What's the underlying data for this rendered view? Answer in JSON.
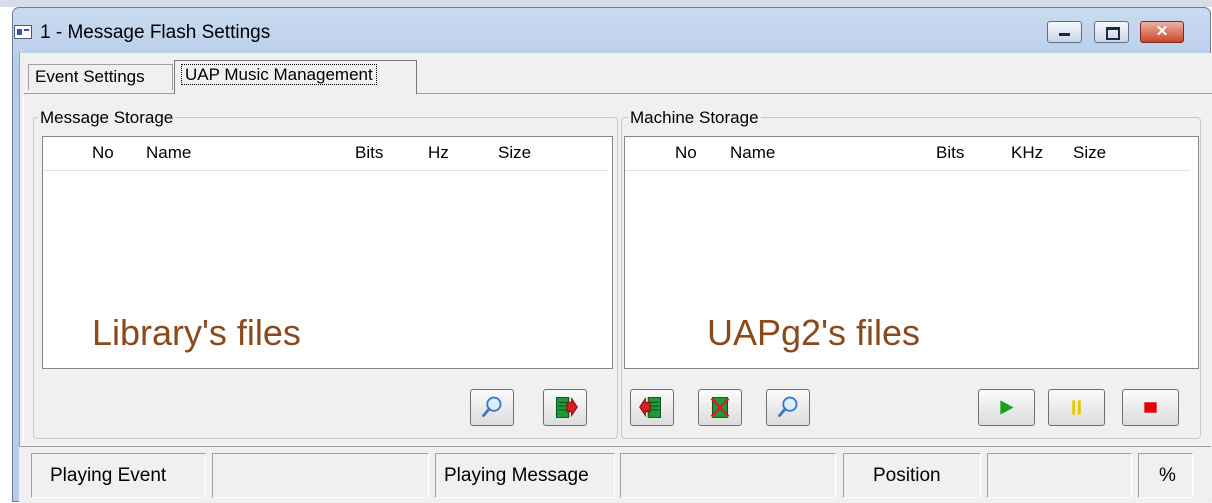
{
  "window": {
    "title": "1 - Message Flash Settings",
    "close_glyph": "✕"
  },
  "tabs": [
    {
      "label": "Event Settings",
      "active": false
    },
    {
      "label": "UAP Music Management",
      "active": true
    }
  ],
  "message_storage": {
    "legend": "Message Storage",
    "columns": [
      "No",
      "Name",
      "Bits",
      "Hz",
      "Size"
    ],
    "rows": [],
    "watermark": "Library's files"
  },
  "machine_storage": {
    "legend": "Machine Storage",
    "columns": [
      "No",
      "Name",
      "Bits",
      "KHz",
      "Size"
    ],
    "rows": [],
    "watermark": "UAPg2's files"
  },
  "toolbar_icons": {
    "left": [
      "search-icon",
      "export-to-machine-icon"
    ],
    "right": [
      "import-from-machine-icon",
      "delete-file-icon",
      "search-icon",
      "play-icon",
      "pause-icon",
      "stop-icon"
    ]
  },
  "status_bar": {
    "playing_event_label": "Playing Event",
    "playing_event_value": "",
    "playing_message_label": "Playing Message",
    "playing_message_value": "",
    "position_label": "Position",
    "position_value": "",
    "percent_label": "%"
  },
  "colors": {
    "watermark": "#8a4a1e",
    "play": "#1aa01a",
    "pause": "#e6c800",
    "stop": "#e60000",
    "file_green": "#1e9a3a",
    "arrow_red": "#d42020"
  }
}
